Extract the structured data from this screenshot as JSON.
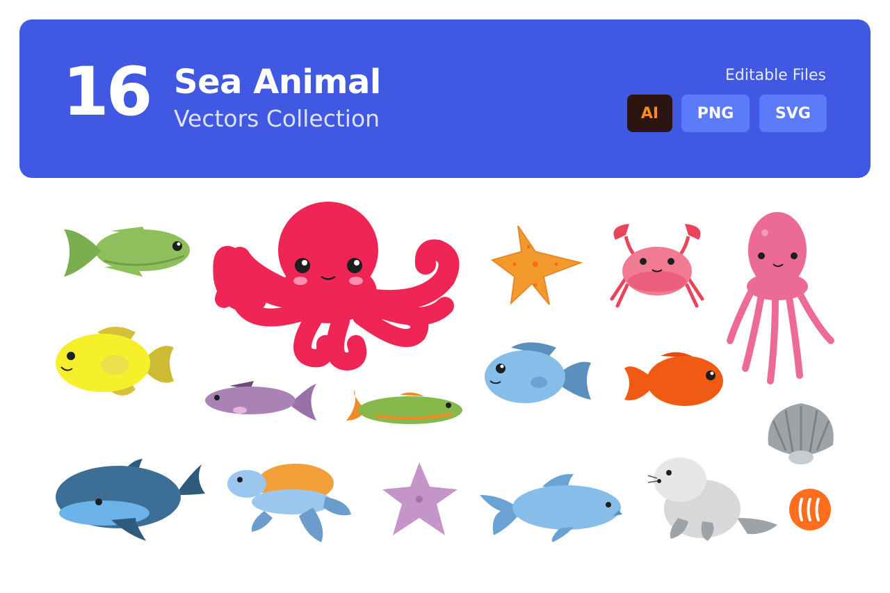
{
  "header": {
    "count": "16",
    "title": "Sea Animal",
    "subtitle": "Vectors Collection",
    "editable_label": "Editable Files",
    "formats": [
      "AI",
      "PNG",
      "SVG"
    ]
  },
  "colors": {
    "banner": "#4159e2",
    "format_badge": "#5b7bfa",
    "ai_badge": "#2a1510",
    "ai_text": "#ff8a1f",
    "logo": "#ff6d1f"
  }
}
